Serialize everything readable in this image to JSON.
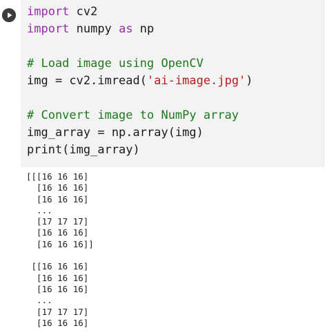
{
  "cell": {
    "run_icon": "play-circle-icon",
    "code": {
      "line1": {
        "kw": "import",
        "rest": " cv2"
      },
      "line2": {
        "kw1": "import",
        "mid": " numpy ",
        "kw2": "as",
        "rest": " np"
      },
      "line3": "",
      "line4": "# Load image using OpenCV",
      "line5": {
        "pre": "img = cv2.imread(",
        "str": "'ai-image.jpg'",
        "post": ")"
      },
      "line6": "",
      "line7": "# Convert image to NumPy array",
      "line8": "img_array = np.array(img)",
      "line9": "print(img_array)"
    }
  },
  "output": {
    "lines": [
      "[[[16 16 16]",
      "  [16 16 16]",
      "  [16 16 16]",
      "  ...",
      "  [17 17 17]",
      "  [16 16 16]",
      "  [16 16 16]]",
      "",
      " [[16 16 16]",
      "  [16 16 16]",
      "  [16 16 16]",
      "  ...",
      "  [17 17 17]",
      "  [16 16 16]"
    ]
  },
  "colors": {
    "editor_bg": "#f3f3f3",
    "keyword": "#9c27b0",
    "string": "#b71c1c",
    "comment": "#1b7a1b",
    "run_button": "#3c3c3c"
  }
}
